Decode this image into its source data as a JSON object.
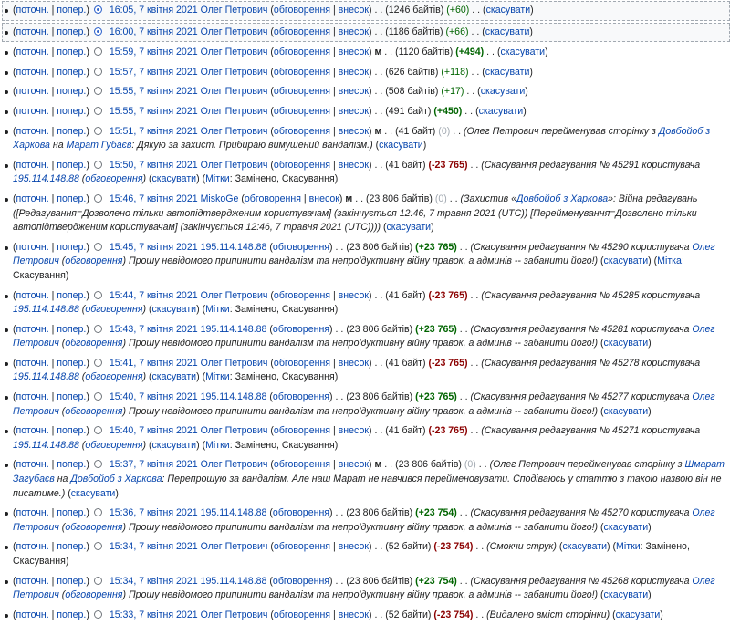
{
  "labels": {
    "cur": "поточн.",
    "prev": "попер.",
    "talk": "обговорення",
    "contribs": "внесок",
    "undo": "скасувати",
    "tags": "Мітки",
    "tag": "Мітка",
    "tags_value": "Замінено, Скасування",
    "tag_value": "Скасування",
    "minor": "м",
    "sep": "|",
    "dots": ". ."
  },
  "rows": [
    {
      "date": "16:05, 7 квітня 2021",
      "user": "Олег Петрович",
      "size": "(1246 байтів)",
      "diff": "(+60)"
    },
    {
      "date": "16:00, 7 квітня 2021",
      "user": "Олег Петрович",
      "size": "(1186 байтів)",
      "diff": "(+66)"
    },
    {
      "date": "15:59, 7 квітня 2021",
      "user": "Олег Петрович",
      "size": "(1120 байтів)",
      "diff": "(+494)"
    },
    {
      "date": "15:57, 7 квітня 2021",
      "user": "Олег Петрович",
      "size": "(626 байтів)",
      "diff": "(+118)"
    },
    {
      "date": "15:55, 7 квітня 2021",
      "user": "Олег Петрович",
      "size": "(508 байтів)",
      "diff": "(+17)"
    },
    {
      "date": "15:55, 7 квітня 2021",
      "user": "Олег Петрович",
      "size": "(491 байт)",
      "diff": "(+450)"
    },
    {
      "date": "15:51, 7 квітня 2021",
      "user": "Олег Петрович",
      "size": "(41 байт)",
      "diff": "(0)",
      "c1": "(Олег Петрович перейменував сторінку з ",
      "c1link": "Довбойоб з Харкова",
      "c1b": " на ",
      "c1link2": "Марат Губаєв",
      "c1c": ": Дякую за захист. Прибираю вимушений вандалізм.)"
    },
    {
      "date": "15:50, 7 квітня 2021",
      "user": "Олег Петрович",
      "size": "(41 байт)",
      "diff": "(-23 765)",
      "c1": "(Скасування редагування № 45291 користувача ",
      "c1link": "195.114.148.88",
      "c1link2": "обговорення"
    },
    {
      "date": "15:46, 7 квітня 2021",
      "user": "MiskoGe",
      "size": "(23 806 байтів)",
      "diff": "(0)",
      "c1": "(Захистив «",
      "c1link": "Довбойоб з Харкова",
      "c1b": "»: Війна редагувань ([Редагування=Дозволено тільки автопідтвердженим користувачам] (закінчується 12:46, 7 травня 2021 (UTC)) [Перейменування=Дозволено тільки автопідтвердженим користувачам] (закінчується 12:46, 7 травня 2021 (UTC))))"
    },
    {
      "date": "15:45, 7 квітня 2021",
      "user": "195.114.148.88",
      "size": "(23 806 байтів)",
      "diff": "(+23 765)",
      "c1": "(Скасування редагування № 45290 користувача ",
      "c1link": "Олег Петрович",
      "c1link2": "обговорення",
      "c1c": " Прошу невідомого припинити вандалізм та непро'дуктивну війну правок, а админів -- забанити його!)"
    },
    {
      "date": "15:44, 7 квітня 2021",
      "user": "Олег Петрович",
      "size": "(41 байт)",
      "diff": "(-23 765)",
      "c1": "(Скасування редагування № 45285 користувача ",
      "c1link": "195.114.148.88",
      "c1link2": "обговорення"
    },
    {
      "date": "15:43, 7 квітня 2021",
      "user": "195.114.148.88",
      "size": "(23 806 байтів)",
      "diff": "(+23 765)",
      "c1": "(Скасування редагування № 45281 користувача ",
      "c1link": "Олег Петрович",
      "c1link2": "обговорення",
      "c1c": " Прошу невідомого припинити вандалізм та непро'дуктивну війну правок, а админів -- забанити його!)"
    },
    {
      "date": "15:41, 7 квітня 2021",
      "user": "Олег Петрович",
      "size": "(41 байт)",
      "diff": "(-23 765)",
      "c1": "(Скасування редагування № 45278 користувача ",
      "c1link": "195.114.148.88",
      "c1link2": "обговорення"
    },
    {
      "date": "15:40, 7 квітня 2021",
      "user": "195.114.148.88",
      "size": "(23 806 байтів)",
      "diff": "(+23 765)",
      "c1": "(Скасування редагування № 45277 користувача ",
      "c1link": "Олег Петрович",
      "c1link2": "обговорення",
      "c1c": " Прошу невідомого припинити вандалізм та непро'дуктивну війну правок, а админів -- забанити його!)"
    },
    {
      "date": "15:40, 7 квітня 2021",
      "user": "Олег Петрович",
      "size": "(41 байт)",
      "diff": "(-23 765)",
      "c1": "(Скасування редагування № 45271 користувача ",
      "c1link": "195.114.148.88",
      "c1link2": "обговорення"
    },
    {
      "date": "15:37, 7 квітня 2021",
      "user": "Олег Петрович",
      "size": "(23 806 байтів)",
      "diff": "(0)",
      "c1": "(Олег Петрович перейменував сторінку з ",
      "c1link": "Шмарат Загубаєв",
      "c1b": " на ",
      "c1link2": "Довбойоб з Харкова",
      "c1c": ": Перепрошую за вандалізм. Але наш Марат не навчився перейменовувати. Сподіваюсь у статтю з такою назвою він не писатиме.)"
    },
    {
      "date": "15:36, 7 квітня 2021",
      "user": "195.114.148.88",
      "size": "(23 806 байтів)",
      "diff": "(+23 754)",
      "c1": "(Скасування редагування № 45270 користувача ",
      "c1link": "Олег Петрович",
      "c1link2": "обговорення",
      "c1c": " Прошу невідомого припинити вандалізм та непро'дуктивну війну правок, а админів -- забанити його!)"
    },
    {
      "date": "15:34, 7 квітня 2021",
      "user": "Олег Петрович",
      "size": "(52 байти)",
      "diff": "(-23 754)",
      "c1": "(Смокчи струк)"
    },
    {
      "date": "15:34, 7 квітня 2021",
      "user": "195.114.148.88",
      "size": "(23 806 байтів)",
      "diff": "(+23 754)",
      "c1": "(Скасування редагування № 45268 користувача ",
      "c1link": "Олег Петрович",
      "c1link2": "обговорення",
      "c1c": " Прошу невідомого припинити вандалізм та непро'дуктивну війну правок, а админів -- забанити його!)"
    },
    {
      "date": "15:33, 7 квітня 2021",
      "user": "Олег Петрович",
      "size": "(52 байти)",
      "diff": "(-23 754)",
      "c1": "(Видалено вміст сторінки)"
    }
  ]
}
